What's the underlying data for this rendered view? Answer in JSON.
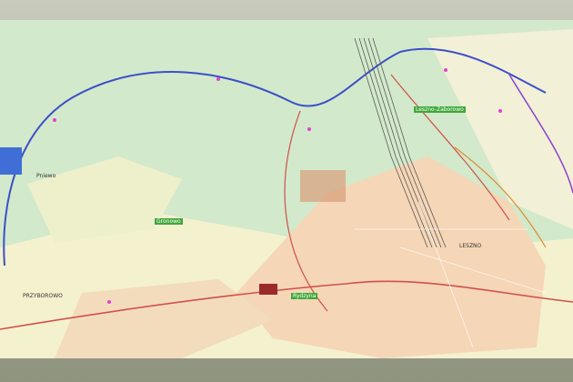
{
  "map": {
    "place_labels": [
      {
        "key": "przyborowo",
        "text": "PRZYBOROWO"
      },
      {
        "key": "pniewo",
        "text": "Pniewo"
      },
      {
        "key": "leszno",
        "text": "LESZNO"
      }
    ],
    "green_labels": [
      {
        "key": "g1",
        "text": "Leszno-Zaborowo"
      },
      {
        "key": "g2",
        "text": "Gronowo"
      },
      {
        "key": "g3",
        "text": "Rydzyna"
      }
    ],
    "colors": {
      "forest": "#cfe6c6",
      "field": "#f3f1cf",
      "urban": "#f6d8b8",
      "ring_road_blue": "#3d4fc8",
      "road_red": "#d0504a",
      "rail": "#5a5a5a",
      "purple_route": "#8a3fd0",
      "magenta_marker": "#e43fd0"
    }
  }
}
